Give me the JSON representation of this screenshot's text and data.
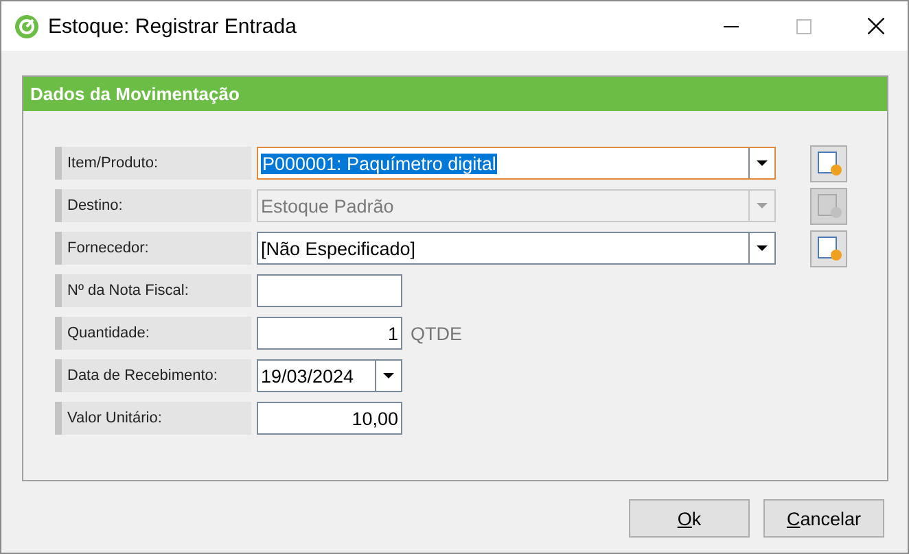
{
  "window": {
    "title": "Estoque: Registrar Entrada"
  },
  "group": {
    "title": "Dados da Movimentação"
  },
  "fields": [
    {
      "label": "Item/Produto:",
      "kind": "combo",
      "value": "P000001: Paquímetro digital",
      "disabled": false,
      "focused": true,
      "highlighted": true,
      "side_button": {
        "disabled": false
      }
    },
    {
      "label": "Destino:",
      "kind": "combo",
      "value": "Estoque Padrão",
      "disabled": true,
      "focused": false,
      "highlighted": false,
      "side_button": {
        "disabled": true
      }
    },
    {
      "label": "Fornecedor:",
      "kind": "combo",
      "value": "[Não Especificado]",
      "disabled": false,
      "focused": false,
      "highlighted": false,
      "side_button": {
        "disabled": false
      }
    },
    {
      "label": "Nº da Nota Fiscal:",
      "kind": "text",
      "disabled": false,
      "focused": false
    },
    {
      "label": "Quantidade:",
      "kind": "number",
      "value": "1",
      "unit": "QTDE",
      "disabled": false,
      "focused": false,
      "highlighted": false
    },
    {
      "label": "Data de Recebimento:",
      "kind": "date",
      "value": "19/03/2024",
      "disabled": false,
      "focused": false,
      "highlighted": false
    },
    {
      "label": "Valor Unitário:",
      "kind": "number",
      "value": "10,00",
      "disabled": false,
      "focused": false,
      "highlighted": false
    }
  ],
  "buttons": [
    {
      "label": "Ok"
    },
    {
      "label": "Cancelar"
    }
  ]
}
